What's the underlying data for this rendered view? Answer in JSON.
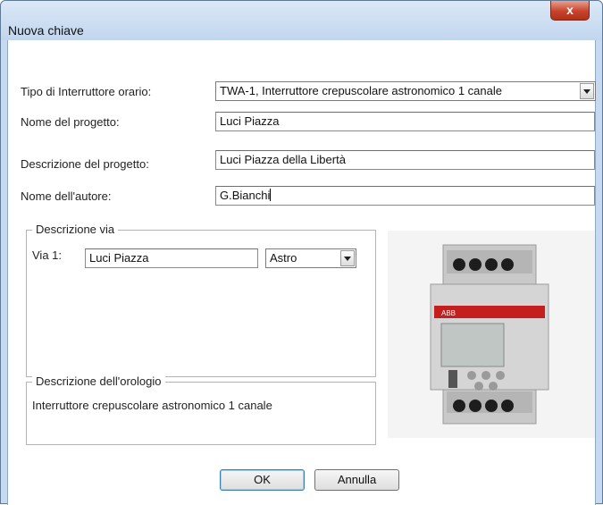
{
  "window": {
    "title": "Nuova chiave",
    "close_label": "x"
  },
  "form": {
    "tipo_label": "Tipo di Interruttore orario:",
    "tipo_value": "TWA-1, Interruttore crepuscolare astronomico 1 canale",
    "nome_label": "Nome del progetto:",
    "nome_value": "Luci Piazza",
    "descr_label": "Descrizione del progetto:",
    "descr_value": "Luci Piazza della Libertà",
    "autore_label": "Nome dell'autore:",
    "autore_value": "G.Bianchi"
  },
  "via_group": {
    "legend": "Descrizione via",
    "via1_label": "Via 1:",
    "via1_value": "Luci Piazza",
    "via1_mode": "Astro"
  },
  "clock_group": {
    "legend": "Descrizione dell'orologio",
    "text": "Interruttore crepuscolare astronomico 1 canale"
  },
  "device_image": {
    "brand": "ABB"
  },
  "buttons": {
    "ok": "OK",
    "cancel": "Annulla"
  }
}
